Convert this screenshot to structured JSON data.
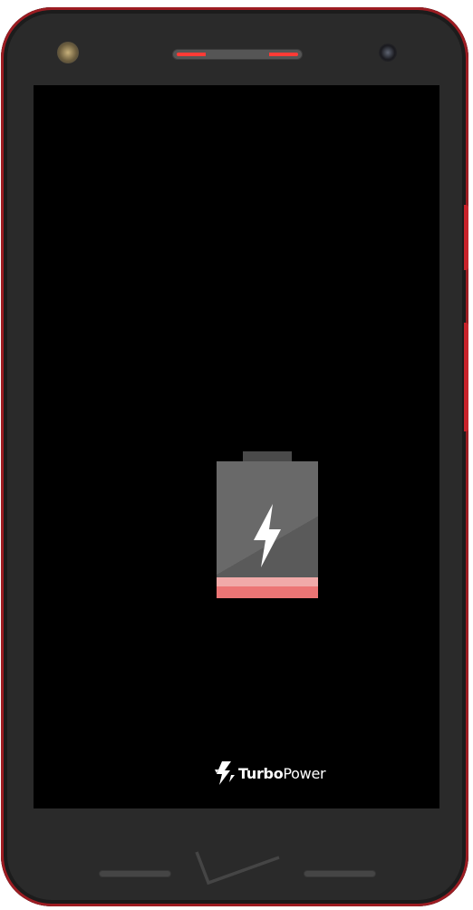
{
  "device": {
    "body_color": "#2a2a2a",
    "accent_color": "#c8232b",
    "screen_color": "#000000"
  },
  "charging_screen": {
    "battery": {
      "level_percent": 15,
      "fill_color": "#ec7575",
      "empty_color": "#5a5a5a",
      "icon": "lightning-bolt-icon"
    },
    "brand": {
      "icon": "turbopower-bolt-icon",
      "name_part1": "Turbo",
      "name_part2": "Power"
    }
  },
  "hardware": {
    "carrier_logo": "check-logo-icon"
  }
}
